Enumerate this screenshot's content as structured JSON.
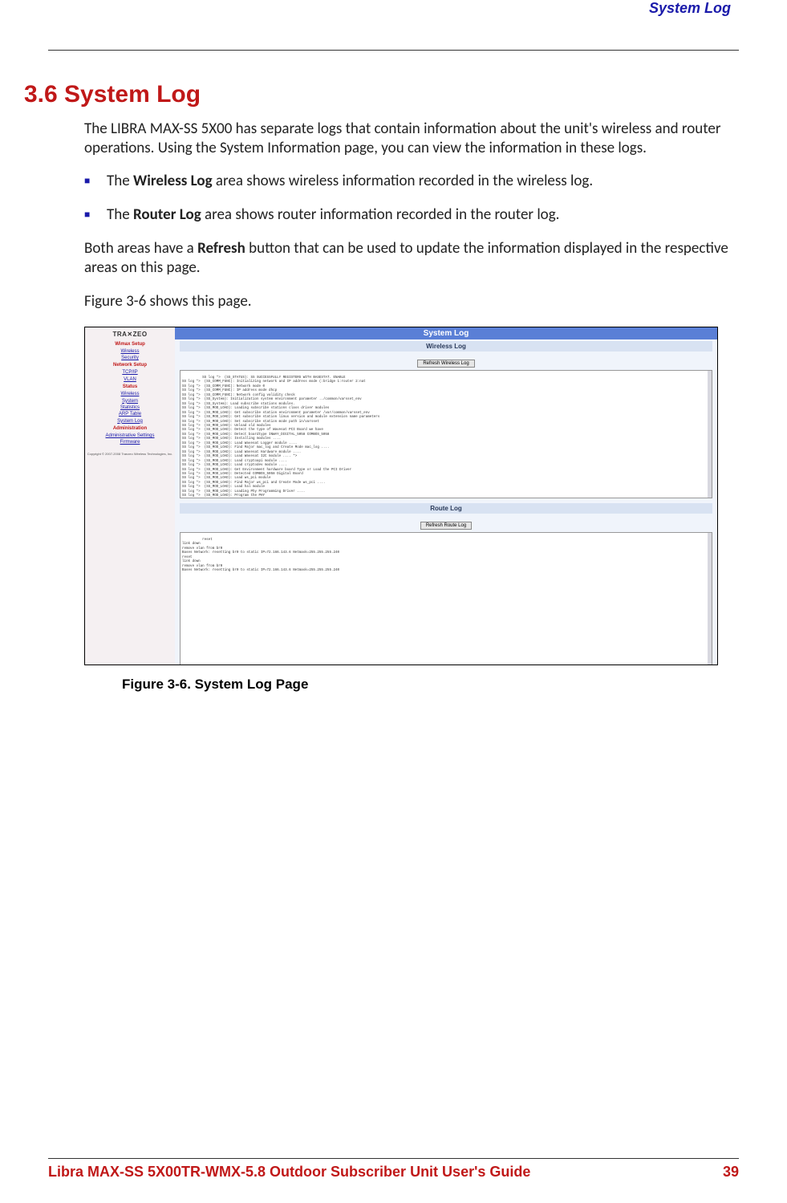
{
  "header": {
    "section": "System Log"
  },
  "h1": "3.6 System Log",
  "intro": "The LIBRA MAX-SS 5X00  has separate logs that contain information about the unit's wireless and router operations. Using the System Information page, you can view the information in these logs.",
  "bullets": [
    {
      "prefix": "The ",
      "bold": "Wireless Log",
      "suffix": " area shows wireless information recorded in the wireless log."
    },
    {
      "prefix": "The ",
      "bold": "Router Log",
      "suffix": " area shows router information recorded in the router log."
    }
  ],
  "para_refresh_a": "Both areas have a ",
  "para_refresh_bold": "Refresh",
  "para_refresh_b": " button that can be used to update the information displayed in the respective areas on this page.",
  "para_figref": "Figure 3-6 shows this page.",
  "sidebar": {
    "logo": "TRA✕ZEO",
    "groups": [
      {
        "title": "Wimax Setup",
        "links": [
          "Wireless",
          "Security"
        ]
      },
      {
        "title": "Network Setup",
        "links": [
          "TCP/IP",
          "VLAN"
        ]
      },
      {
        "title": "Status",
        "links": [
          "Wireless",
          "System",
          "Statistics",
          "ARP Table",
          "System Log"
        ]
      },
      {
        "title": "Administration",
        "links": [
          "Administrative Settings",
          "Firmware"
        ]
      }
    ],
    "copyright": "Copyright © 2007-2008 Tranzeo Wireless\nTechnologies, Inc."
  },
  "panel": {
    "title": "System Log",
    "wireless": {
      "title": "Wireless Log",
      "button": "Refresh Wireless Log",
      "content": "SS log *>  (SS_STATUS): SS SUCCESSFULLY REGISTERS WITH BASESTAT. ENABLE\nSS log *>  (SS_COMM_FUNC): Initializing network and IP address mode (:bridge 1:router 2:nat\nSS log *>  (SS_COMM_FUNC): Network mode 0\nSS log *>  (SS_COMM_FUNC): IP address mode dhcp\nSS log *>  (SS_COMM_FUNC): Network config validity check\nSS log *>  (SS_System): Initialization system environment parameter ../common/varsset_env\nSS log *>  (SS_System): Load subscribe stations modules.\nSS log *>  (SS_MOD_LOAD): Loading subscribe stations class driver modules\nSS log *>  (SS_MOD_LOAD): Get subscribe station environment parameter /var/common/varsset_env\nSS log *>  (SS_MOD_LOAD): Get subscribe station linux version and module extension name parameters\nSS log *>  (SS_MOD_LOAD): Set subscribe station mode path in/varsset\nSS log *>  (SS_MOD_LOAD): Unload old modules\nSS log *>  (SS_MOD_LOAD): Detect the type of Wavesat PCI Board we have\nSS log *>  (SS_MOD_LOAD): Detect boardtype INWAY_DIGITAL_5058 COMBOS_5058\nSS log *>  (SS_MOD_LOAD): Installing modules ....\nSS log *>  (SS_MOD_LOAD): Load Wavesat Logger module ....\nSS log *>  (SS_MOD_LOAD): Find Major mac_log and Create Mode mac_log ....\nSS log *>  (SS_MOD_LOAD): Load Wavesat Hardware module ....\nSS log *>  (SS_MOD_LOAD): Load Wavesat I2C module .... *>\nSS log *>  (SS_MOD_LOAD): Load cryptoapi module ....\nSS log *>  (SS_MOD_LOAD): Load cryptodev module ....\nSS log *>  (SS_MOD_LOAD): Get Environment hardware board Type or Load the PCI Driver\nSS log *>  (SS_MOD_LOAD): Detected COMBOS_5058 Digital Board\nSS log *>  (SS_MOD_LOAD): Load ws_pci module\nSS log *>  (SS_MOD_LOAD): Find Major ws_pci and Create Mode ws_pci ....\nSS log *>  (SS_MOD_LOAD): Load hal module\nSS log *>  (SS_MOD_LOAD): Loading Phy Programming Driver ....\nSS log *>  (SS_MOD_LOAD): Program the PHY\nSS log *>  (SS_MOD_LOAD): Load PHY module ....\nSS log *>  (SS_MOD_LOAD): Load sharklin module ....\nSS log *>  (SS_MOD_LOAD): Find Major shark and Create Mode shark_ipc:"
    },
    "route": {
      "title": "Route Log",
      "button": "Refresh Route Log",
      "content": "reset\nlink down\nremove vlan from br0\nBases Network: resetting br0 to static IP=72.166.143.6 Netmask=255.255.255.240\nreset\nlink down\nremove vlan from br0\nBases Network: resetting br0 to static IP=72.166.143.6 Netmask=255.255.255.240"
    }
  },
  "figcaption": "Figure 3-6. System Log Page",
  "footer": {
    "title": "Libra MAX-SS  5X00TR-WMX-5.8 Outdoor Subscriber Unit User's Guide",
    "page": "39"
  }
}
